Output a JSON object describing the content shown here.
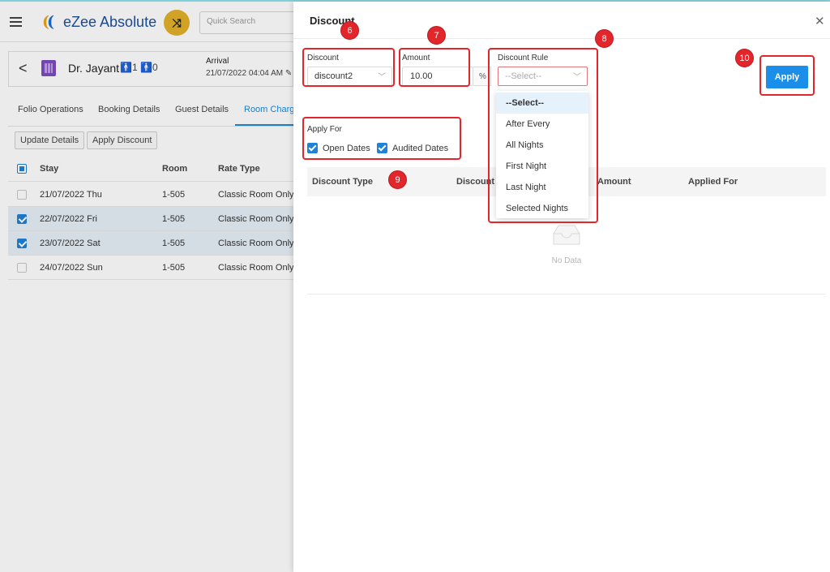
{
  "app": {
    "name": "eZee Absolute",
    "search_placeholder": "Quick Search",
    "guest": {
      "name": "Dr. Jayant",
      "adults": "1",
      "children": "0"
    },
    "arrival": {
      "label": "Arrival",
      "value": "21/07/2022 04:04 AM"
    },
    "tabs": [
      "Folio Operations",
      "Booking Details",
      "Guest Details",
      "Room Charges"
    ],
    "active_tab": "Room Charges",
    "actions": {
      "update_details": "Update Details",
      "apply_discount": "Apply Discount"
    },
    "table": {
      "headers": {
        "stay": "Stay",
        "room": "Room",
        "rate_type": "Rate Type"
      },
      "rows": [
        {
          "stay": "21/07/2022 Thu",
          "room": "1-505",
          "rate_type": "Classic Room Only",
          "checked": false
        },
        {
          "stay": "22/07/2022 Fri",
          "room": "1-505",
          "rate_type": "Classic Room Only",
          "checked": true
        },
        {
          "stay": "23/07/2022 Sat",
          "room": "1-505",
          "rate_type": "Classic Room Only",
          "checked": true
        },
        {
          "stay": "24/07/2022 Sun",
          "room": "1-505",
          "rate_type": "Classic Room Only",
          "checked": false
        }
      ]
    }
  },
  "drawer": {
    "title": "Discount",
    "close_icon": "close-icon",
    "discount": {
      "label": "Discount",
      "value": "discount2"
    },
    "amount": {
      "label": "Amount",
      "value": "10.00",
      "unit": "%"
    },
    "discount_rule": {
      "label": "Discount Rule",
      "placeholder": "--Select--",
      "options": [
        "--Select--",
        "After Every",
        "All Nights",
        "First Night",
        "Last Night",
        "Selected Nights"
      ],
      "highlighted": "--Select--"
    },
    "apply_label": "Apply",
    "apply_for": {
      "label": "Apply For",
      "open_dates": {
        "label": "Open Dates",
        "checked": true
      },
      "audited_dates": {
        "label": "Audited Dates",
        "checked": true
      }
    },
    "grid": {
      "columns": [
        "Discount Type",
        "Discount R",
        "Amount",
        "Applied For"
      ],
      "empty_text": "No Data"
    }
  },
  "callouts": [
    "6",
    "7",
    "8",
    "9",
    "10"
  ],
  "colors": {
    "primary": "#1a8ee8",
    "callout": "#e3262b",
    "logo_accent": "#f2a415"
  }
}
